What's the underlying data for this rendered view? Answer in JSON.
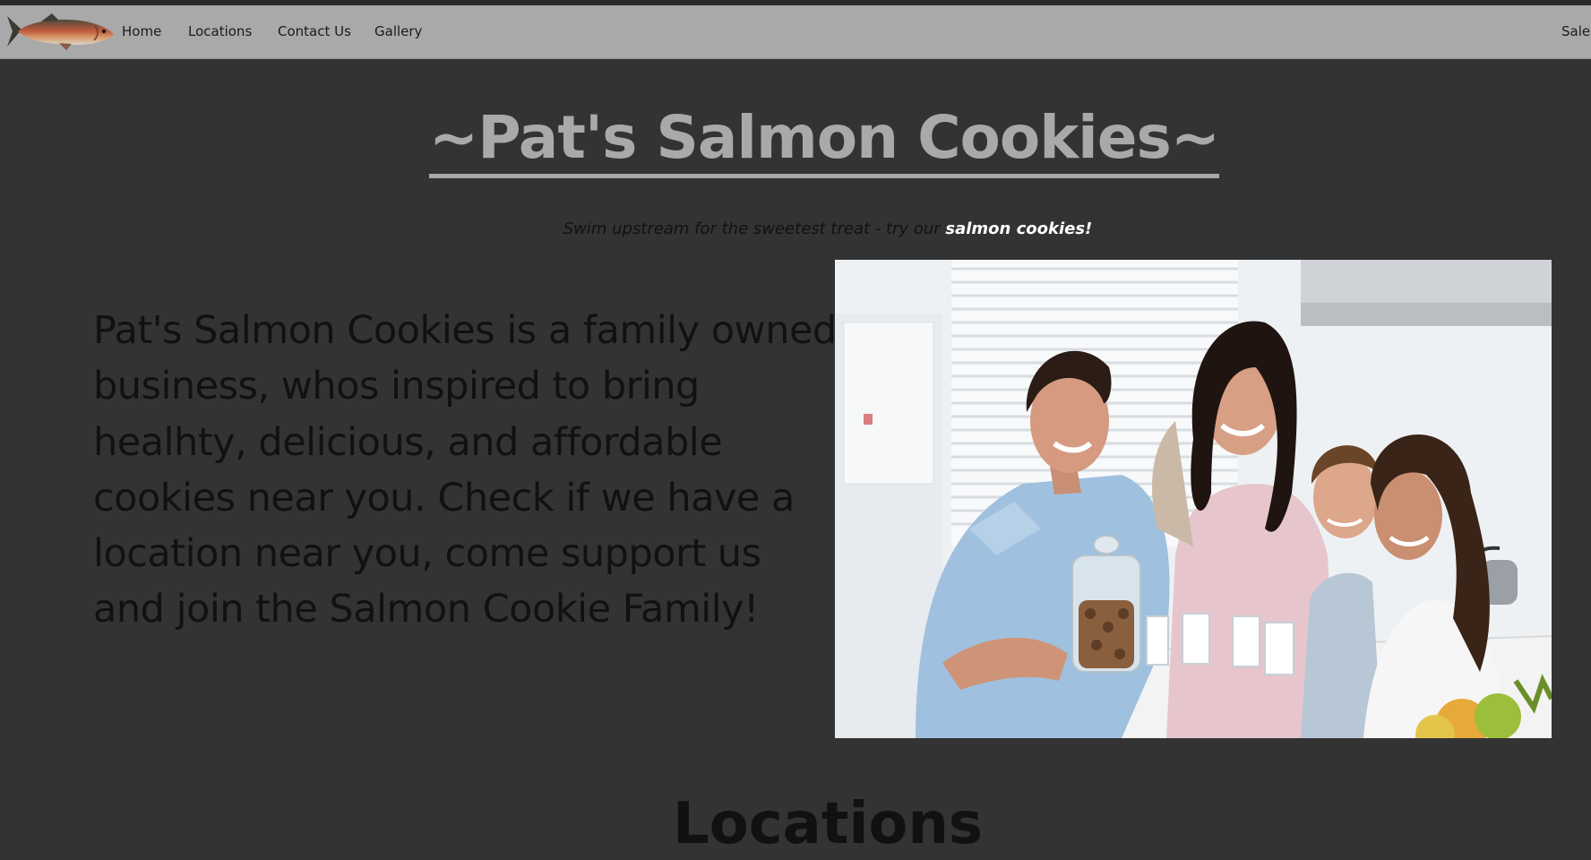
{
  "nav": {
    "logo_icon": "salmon-fish-icon",
    "links": [
      "Home",
      "Locations",
      "Contact Us",
      "Gallery"
    ],
    "right_link": "Sales"
  },
  "hero": {
    "title": "~Pat's Salmon Cookies~",
    "tagline_prefix": "Swim upstream for the sweetest treat - try our ",
    "tagline_accent": "salmon cookies!"
  },
  "intro": {
    "text": "Pat's Salmon Cookies is a family owned business, whos inspired to bring healhty, delicious, and affordable cookies near you. Check if we have a location near you, come support us and join the Salmon Cookie Family!"
  },
  "photo": {
    "icon": "family-kitchen-photo"
  },
  "locations": {
    "heading": "Locations"
  },
  "colors": {
    "page_background": "#333333",
    "nav_background": "#a9a9a9",
    "title_color": "#a9a9a9",
    "accent_text": "#ffffff"
  }
}
